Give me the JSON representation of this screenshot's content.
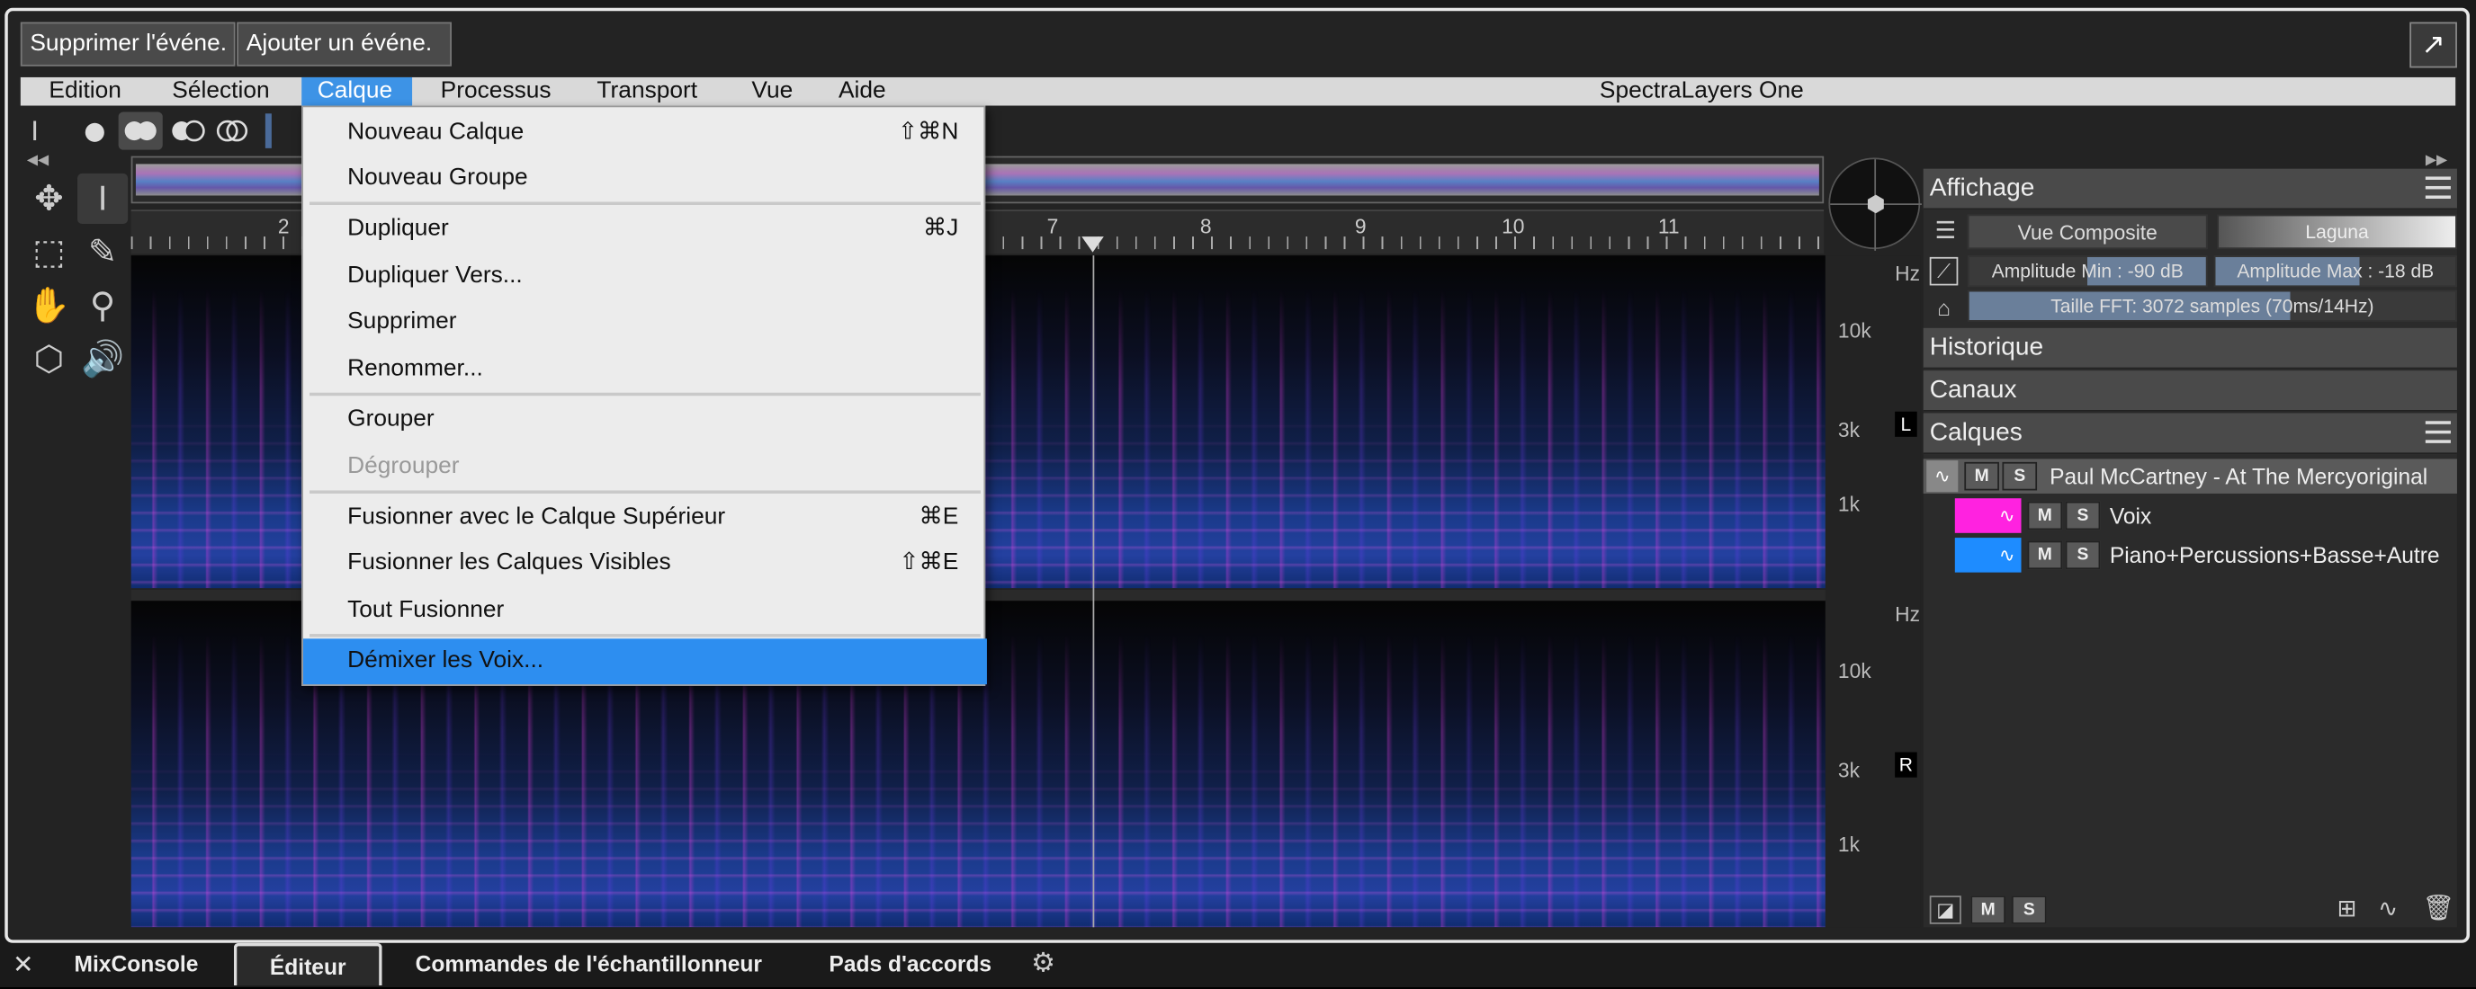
{
  "top_buttons": {
    "delete_event": "Supprimer l'événe.",
    "add_event": "Ajouter un événe."
  },
  "menu": {
    "items": [
      "Edition",
      "Sélection",
      "Calque",
      "Processus",
      "Transport",
      "Vue",
      "Aide"
    ],
    "active": "Calque",
    "app_title": "SpectraLayers One"
  },
  "dropdown": {
    "items": [
      {
        "label": "Nouveau Calque",
        "shortcut": "⇧⌘N"
      },
      {
        "label": "Nouveau Groupe",
        "shortcut": ""
      },
      {
        "label": "Dupliquer",
        "shortcut": "⌘J"
      },
      {
        "label": "Dupliquer Vers...",
        "shortcut": ""
      },
      {
        "label": "Supprimer",
        "shortcut": ""
      },
      {
        "label": "Renommer...",
        "shortcut": ""
      },
      {
        "label": "Grouper",
        "shortcut": ""
      },
      {
        "label": "Dégrouper",
        "shortcut": ""
      },
      {
        "label": "Fusionner avec le Calque Supérieur",
        "shortcut": "⌘E"
      },
      {
        "label": "Fusionner les Calques Visibles",
        "shortcut": "⇧⌘E"
      },
      {
        "label": "Tout Fusionner",
        "shortcut": ""
      },
      {
        "label": "Démixer les Voix...",
        "shortcut": ""
      }
    ]
  },
  "ruler": {
    "ticks": [
      "2",
      "7",
      "8",
      "9",
      "10",
      "11"
    ]
  },
  "freq": {
    "unit": "Hz",
    "top": [
      "10k",
      "3k",
      "1k"
    ],
    "bottom": [
      "10k",
      "3k",
      "1k"
    ]
  },
  "channels": {
    "left": "L",
    "right": "R"
  },
  "panel": {
    "affichage": "Affichage",
    "vue_composite": "Vue Composite",
    "laguna": "Laguna",
    "amp_min": "Amplitude Min : -90 dB",
    "amp_max": "Amplitude Max : -18 dB",
    "fft": "Taille FFT: 3072 samples (70ms/14Hz)",
    "historique": "Historique",
    "canaux": "Canaux",
    "calques": "Calques",
    "layers": [
      {
        "name": "Paul McCartney - At The Mercyoriginal",
        "color": "#888888"
      },
      {
        "name": "Voix",
        "color": "#ff22e0"
      },
      {
        "name": "Piano+Percussions+Basse+Autre",
        "color": "#1e8cff"
      }
    ],
    "m": "M",
    "s": "S"
  },
  "tabs": {
    "items": [
      "MixConsole",
      "Éditeur",
      "Commandes de l'échantillonneur",
      "Pads d'accords"
    ],
    "active": "Éditeur"
  }
}
